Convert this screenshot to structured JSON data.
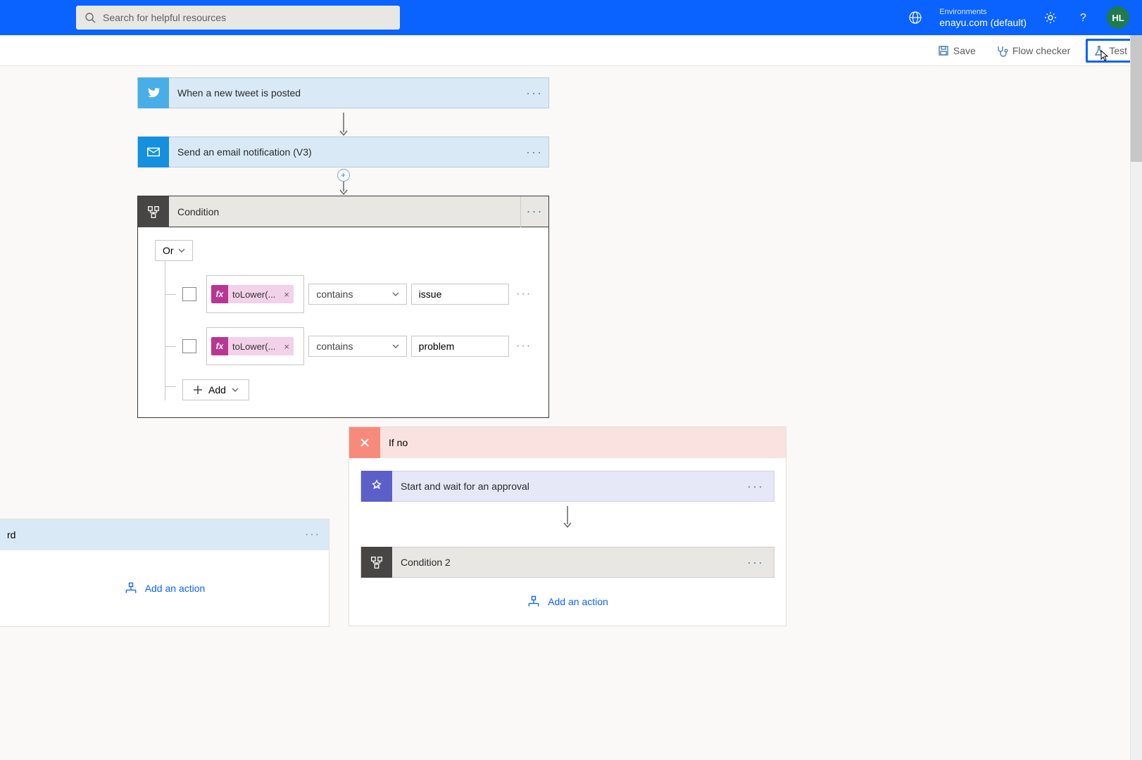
{
  "topbar": {
    "search_placeholder": "Search for helpful resources",
    "env_label": "Environments",
    "env_name": "enayu.com (default)",
    "avatar_initials": "HL"
  },
  "actionbar": {
    "save": "Save",
    "checker": "Flow checker",
    "test": "Test"
  },
  "steps": {
    "trigger": "When a new tweet is posted",
    "mail": "Send an email notification (V3)",
    "condition": "Condition",
    "condition2": "Condition 2",
    "approval": "Start and wait for an approval"
  },
  "condition": {
    "group_op": "Or",
    "rows": [
      {
        "expr": "toLower(...",
        "operator": "contains",
        "value": "issue"
      },
      {
        "expr": "toLower(...",
        "operator": "contains",
        "value": "problem"
      }
    ],
    "add": "Add"
  },
  "branches": {
    "no_label": "If no",
    "yes_placeholder": "rd",
    "add_action": "Add an action"
  }
}
